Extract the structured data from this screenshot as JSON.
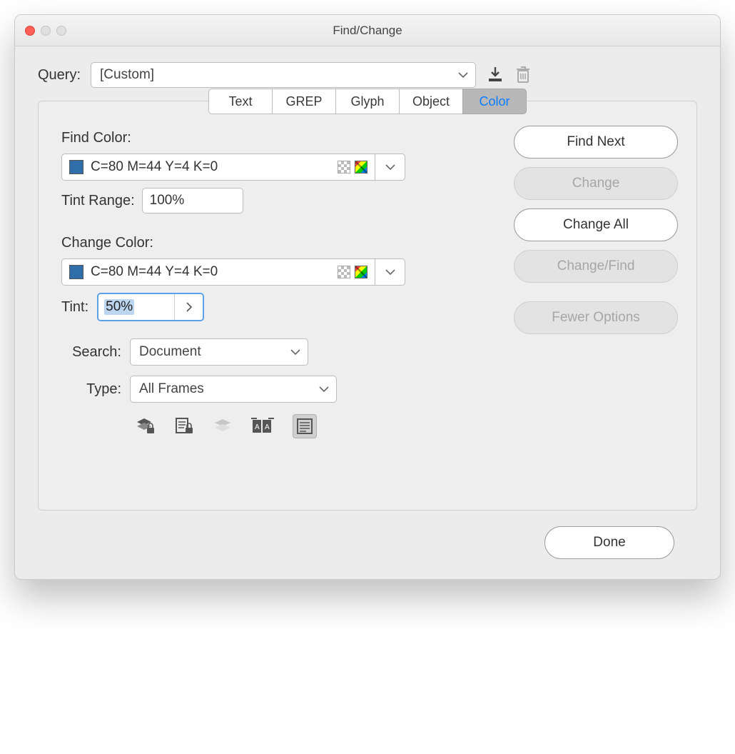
{
  "window": {
    "title": "Find/Change"
  },
  "query": {
    "label": "Query:",
    "value": "[Custom]"
  },
  "tabs": [
    "Text",
    "GREP",
    "Glyph",
    "Object",
    "Color"
  ],
  "active_tab": "Color",
  "find": {
    "section_label": "Find Color:",
    "swatch_name": "C=80 M=44 Y=4 K=0",
    "swatch_color": "#2f6ea8",
    "tint_range_label": "Tint Range:",
    "tint_range_value": "100%"
  },
  "change": {
    "section_label": "Change Color:",
    "swatch_name": "C=80 M=44 Y=4 K=0",
    "swatch_color": "#2f6ea8",
    "tint_label": "Tint:",
    "tint_value": "50%"
  },
  "search": {
    "label": "Search:",
    "value": "Document"
  },
  "type": {
    "label": "Type:",
    "value": "All Frames"
  },
  "buttons": {
    "find_next": "Find Next",
    "change": "Change",
    "change_all": "Change All",
    "change_find": "Change/Find",
    "fewer_options": "Fewer Options",
    "done": "Done"
  }
}
